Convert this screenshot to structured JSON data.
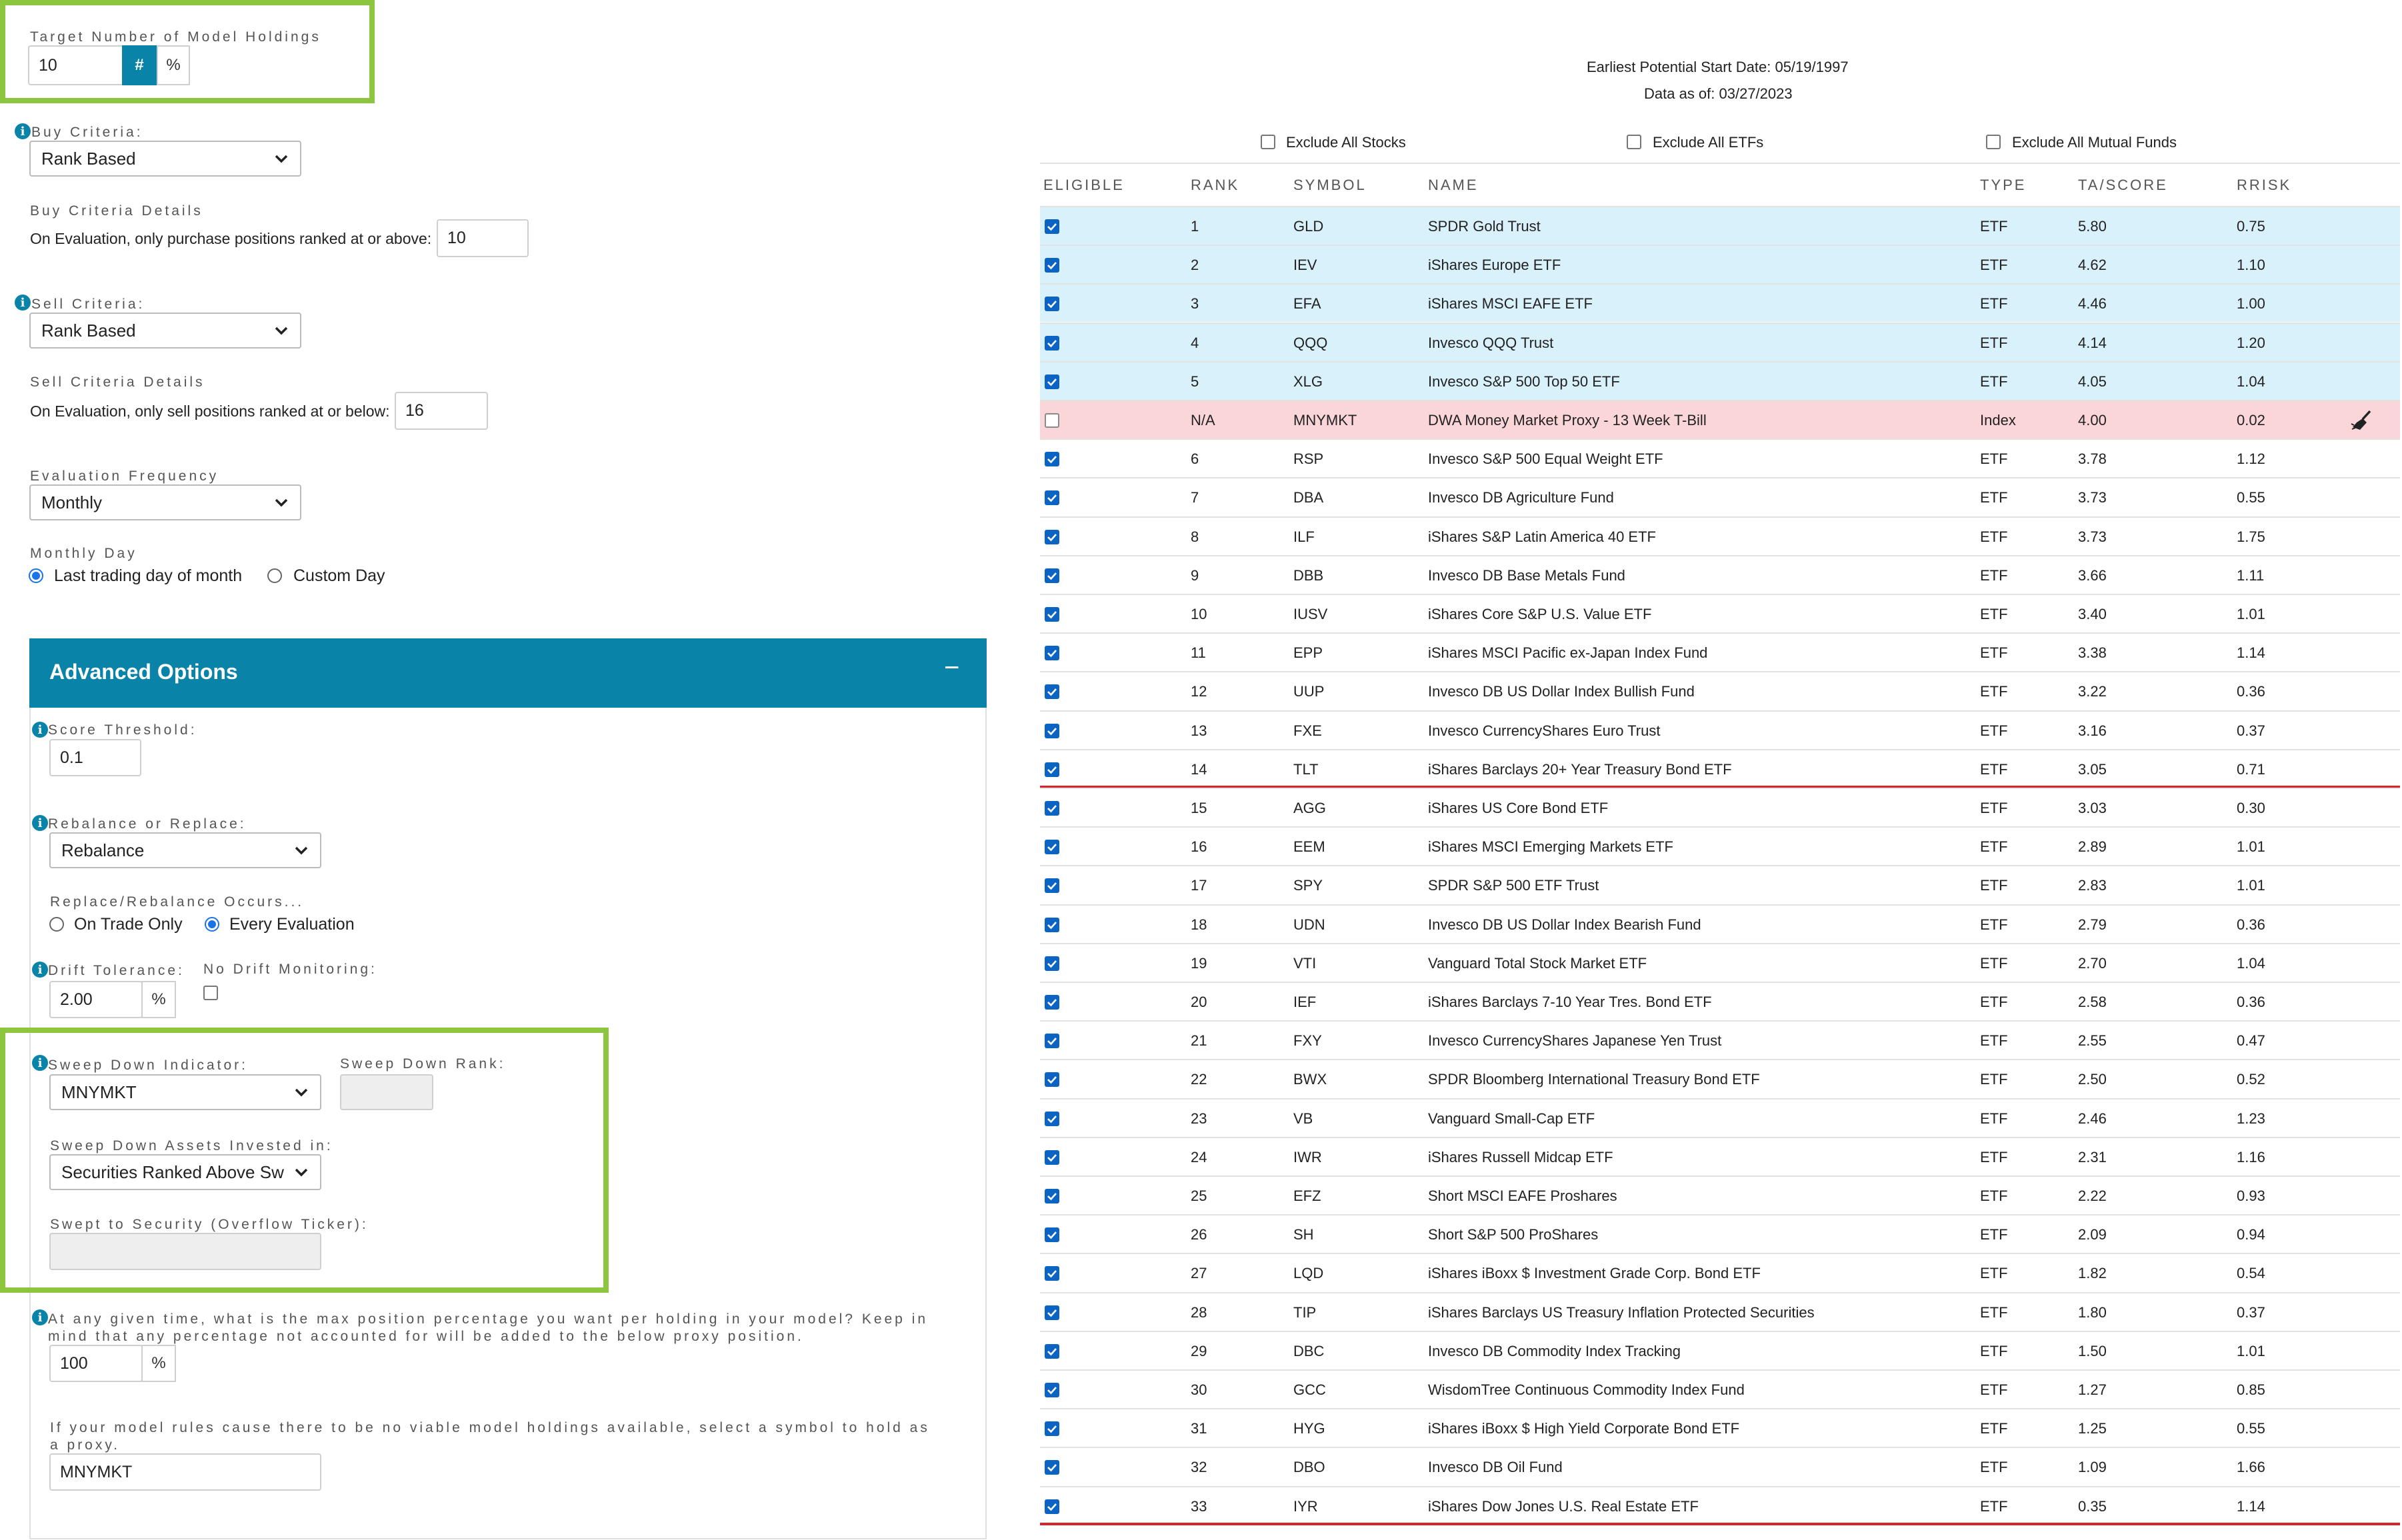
{
  "settings": {
    "target_holdings": {
      "label": "Target Number of Model Holdings",
      "value": "10",
      "hash_btn": "#",
      "pct_btn": "%"
    },
    "buy_criteria": {
      "label": "Buy Criteria:",
      "value": "Rank Based"
    },
    "buy_details": {
      "label": "Buy Criteria Details",
      "text": "On Evaluation, only purchase positions ranked at or above:",
      "value": "10"
    },
    "sell_criteria": {
      "label": "Sell Criteria:",
      "value": "Rank Based"
    },
    "sell_details": {
      "label": "Sell Criteria Details",
      "text": "On Evaluation, only sell positions ranked at or below:",
      "value": "16"
    },
    "evaluation_frequency": {
      "label": "Evaluation Frequency",
      "value": "Monthly"
    },
    "monthly_day": {
      "label": "Monthly Day",
      "option_last": "Last trading day of month",
      "option_custom": "Custom Day",
      "selected": "last"
    }
  },
  "advanced": {
    "title": "Advanced Options",
    "collapse_symbol": "−",
    "score_threshold": {
      "label": "Score Threshold:",
      "value": "0.1"
    },
    "rebalance_or_replace": {
      "label": "Rebalance or Replace:",
      "value": "Rebalance"
    },
    "occurs": {
      "label": "Replace/Rebalance Occurs...",
      "option_trade": "On Trade Only",
      "option_every": "Every Evaluation",
      "selected": "every"
    },
    "drift_tolerance": {
      "label": "Drift Tolerance:",
      "value": "2.00",
      "unit": "%"
    },
    "no_drift": {
      "label": "No Drift Monitoring:",
      "checked": false
    },
    "sweep_indicator": {
      "label": "Sweep Down Indicator:",
      "value": "MNYMKT"
    },
    "sweep_rank": {
      "label": "Sweep Down Rank:",
      "value": ""
    },
    "sweep_assets": {
      "label": "Sweep Down Assets Invested in:",
      "value": "Securities Ranked Above Sw"
    },
    "swept_security": {
      "label": "Swept to Security (Overflow Ticker):",
      "value": ""
    },
    "max_position": {
      "label": "At any given time, what is the max position percentage you want per holding in your model? Keep in mind that any percentage not accounted for will be added to the below proxy position.",
      "value": "100",
      "unit": "%"
    },
    "proxy": {
      "label": "If your model rules cause there to be no viable model holdings available, select a symbol to hold as a proxy.",
      "value": "MNYMKT"
    }
  },
  "info_glyph": "i",
  "header": {
    "start_date": "Earliest Potential Start Date: 05/19/1997",
    "data_as_of": "Data as of: 03/27/2023",
    "exclude_stocks": "Exclude All Stocks",
    "exclude_etfs": "Exclude All ETFs",
    "exclude_funds": "Exclude All Mutual Funds"
  },
  "table": {
    "columns": [
      "ELIGIBLE",
      "RANK",
      "SYMBOL",
      "NAME",
      "TYPE",
      "TA/SCORE",
      "RRISK"
    ],
    "proxy_icon": "broom-icon",
    "rows": [
      {
        "eligible": true,
        "rank": "1",
        "symbol": "GLD",
        "name": "SPDR Gold Trust",
        "type": "ETF",
        "score": "5.80",
        "rrisk": "0.75",
        "style": "held"
      },
      {
        "eligible": true,
        "rank": "2",
        "symbol": "IEV",
        "name": "iShares Europe ETF",
        "type": "ETF",
        "score": "4.62",
        "rrisk": "1.10",
        "style": "held"
      },
      {
        "eligible": true,
        "rank": "3",
        "symbol": "EFA",
        "name": "iShares MSCI EAFE ETF",
        "type": "ETF",
        "score": "4.46",
        "rrisk": "1.00",
        "style": "held"
      },
      {
        "eligible": true,
        "rank": "4",
        "symbol": "QQQ",
        "name": "Invesco QQQ Trust",
        "type": "ETF",
        "score": "4.14",
        "rrisk": "1.20",
        "style": "held"
      },
      {
        "eligible": true,
        "rank": "5",
        "symbol": "XLG",
        "name": "Invesco S&P 500 Top 50 ETF",
        "type": "ETF",
        "score": "4.05",
        "rrisk": "1.04",
        "style": "held"
      },
      {
        "eligible": false,
        "rank": "N/A",
        "symbol": "MNYMKT",
        "name": "DWA Money Market Proxy - 13 Week T-Bill",
        "type": "Index",
        "score": "4.00",
        "rrisk": "0.02",
        "style": "proxy"
      },
      {
        "eligible": true,
        "rank": "6",
        "symbol": "RSP",
        "name": "Invesco S&P 500 Equal Weight ETF",
        "type": "ETF",
        "score": "3.78",
        "rrisk": "1.12",
        "style": ""
      },
      {
        "eligible": true,
        "rank": "7",
        "symbol": "DBA",
        "name": "Invesco DB Agriculture Fund",
        "type": "ETF",
        "score": "3.73",
        "rrisk": "0.55",
        "style": ""
      },
      {
        "eligible": true,
        "rank": "8",
        "symbol": "ILF",
        "name": "iShares S&P Latin America 40 ETF",
        "type": "ETF",
        "score": "3.73",
        "rrisk": "1.75",
        "style": ""
      },
      {
        "eligible": true,
        "rank": "9",
        "symbol": "DBB",
        "name": "Invesco DB Base Metals Fund",
        "type": "ETF",
        "score": "3.66",
        "rrisk": "1.11",
        "style": ""
      },
      {
        "eligible": true,
        "rank": "10",
        "symbol": "IUSV",
        "name": "iShares Core S&P U.S. Value ETF",
        "type": "ETF",
        "score": "3.40",
        "rrisk": "1.01",
        "style": ""
      },
      {
        "eligible": true,
        "rank": "11",
        "symbol": "EPP",
        "name": "iShares MSCI Pacific ex-Japan Index Fund",
        "type": "ETF",
        "score": "3.38",
        "rrisk": "1.14",
        "style": ""
      },
      {
        "eligible": true,
        "rank": "12",
        "symbol": "UUP",
        "name": "Invesco DB US Dollar Index Bullish Fund",
        "type": "ETF",
        "score": "3.22",
        "rrisk": "0.36",
        "style": ""
      },
      {
        "eligible": true,
        "rank": "13",
        "symbol": "FXE",
        "name": "Invesco CurrencyShares Euro Trust",
        "type": "ETF",
        "score": "3.16",
        "rrisk": "0.37",
        "style": ""
      },
      {
        "eligible": true,
        "rank": "14",
        "symbol": "TLT",
        "name": "iShares Barclays 20+ Year Treasury Bond ETF",
        "type": "ETF",
        "score": "3.05",
        "rrisk": "0.71",
        "style": ""
      },
      {
        "eligible": true,
        "rank": "15",
        "symbol": "AGG",
        "name": "iShares US Core Bond ETF",
        "type": "ETF",
        "score": "3.03",
        "rrisk": "0.30",
        "style": ""
      },
      {
        "eligible": true,
        "rank": "16",
        "symbol": "EEM",
        "name": "iShares MSCI Emerging Markets ETF",
        "type": "ETF",
        "score": "2.89",
        "rrisk": "1.01",
        "style": ""
      },
      {
        "eligible": true,
        "rank": "17",
        "symbol": "SPY",
        "name": "SPDR S&P 500 ETF Trust",
        "type": "ETF",
        "score": "2.83",
        "rrisk": "1.01",
        "style": ""
      },
      {
        "eligible": true,
        "rank": "18",
        "symbol": "UDN",
        "name": "Invesco DB US Dollar Index Bearish Fund",
        "type": "ETF",
        "score": "2.79",
        "rrisk": "0.36",
        "style": ""
      },
      {
        "eligible": true,
        "rank": "19",
        "symbol": "VTI",
        "name": "Vanguard Total Stock Market ETF",
        "type": "ETF",
        "score": "2.70",
        "rrisk": "1.04",
        "style": ""
      },
      {
        "eligible": true,
        "rank": "20",
        "symbol": "IEF",
        "name": "iShares Barclays 7-10 Year Tres. Bond ETF",
        "type": "ETF",
        "score": "2.58",
        "rrisk": "0.36",
        "style": ""
      },
      {
        "eligible": true,
        "rank": "21",
        "symbol": "FXY",
        "name": "Invesco CurrencyShares Japanese Yen Trust",
        "type": "ETF",
        "score": "2.55",
        "rrisk": "0.47",
        "style": ""
      },
      {
        "eligible": true,
        "rank": "22",
        "symbol": "BWX",
        "name": "SPDR Bloomberg International Treasury Bond ETF",
        "type": "ETF",
        "score": "2.50",
        "rrisk": "0.52",
        "style": ""
      },
      {
        "eligible": true,
        "rank": "23",
        "symbol": "VB",
        "name": "Vanguard Small-Cap ETF",
        "type": "ETF",
        "score": "2.46",
        "rrisk": "1.23",
        "style": ""
      },
      {
        "eligible": true,
        "rank": "24",
        "symbol": "IWR",
        "name": "iShares Russell Midcap ETF",
        "type": "ETF",
        "score": "2.31",
        "rrisk": "1.16",
        "style": ""
      },
      {
        "eligible": true,
        "rank": "25",
        "symbol": "EFZ",
        "name": "Short MSCI EAFE Proshares",
        "type": "ETF",
        "score": "2.22",
        "rrisk": "0.93",
        "style": ""
      },
      {
        "eligible": true,
        "rank": "26",
        "symbol": "SH",
        "name": "Short S&P 500 ProShares",
        "type": "ETF",
        "score": "2.09",
        "rrisk": "0.94",
        "style": ""
      },
      {
        "eligible": true,
        "rank": "27",
        "symbol": "LQD",
        "name": "iShares iBoxx $ Investment Grade Corp. Bond ETF",
        "type": "ETF",
        "score": "1.82",
        "rrisk": "0.54",
        "style": ""
      },
      {
        "eligible": true,
        "rank": "28",
        "symbol": "TIP",
        "name": "iShares Barclays US Treasury Inflation Protected Securities",
        "type": "ETF",
        "score": "1.80",
        "rrisk": "0.37",
        "style": ""
      },
      {
        "eligible": true,
        "rank": "29",
        "symbol": "DBC",
        "name": "Invesco DB Commodity Index Tracking",
        "type": "ETF",
        "score": "1.50",
        "rrisk": "1.01",
        "style": ""
      },
      {
        "eligible": true,
        "rank": "30",
        "symbol": "GCC",
        "name": "WisdomTree Continuous Commodity Index Fund",
        "type": "ETF",
        "score": "1.27",
        "rrisk": "0.85",
        "style": ""
      },
      {
        "eligible": true,
        "rank": "31",
        "symbol": "HYG",
        "name": "iShares iBoxx $ High Yield Corporate Bond ETF",
        "type": "ETF",
        "score": "1.25",
        "rrisk": "0.55",
        "style": ""
      },
      {
        "eligible": true,
        "rank": "32",
        "symbol": "DBO",
        "name": "Invesco DB Oil Fund",
        "type": "ETF",
        "score": "1.09",
        "rrisk": "1.66",
        "style": ""
      },
      {
        "eligible": true,
        "rank": "33",
        "symbol": "IYR",
        "name": "iShares Dow Jones U.S. Real Estate ETF",
        "type": "ETF",
        "score": "0.35",
        "rrisk": "1.14",
        "style": ""
      }
    ]
  },
  "colors": {
    "accent": "#0a83a8",
    "highlight_green": "#8cc63f",
    "held_row": "#d9f1fa",
    "proxy_row": "#fbd6d9",
    "cut_line": "#d7232c"
  }
}
